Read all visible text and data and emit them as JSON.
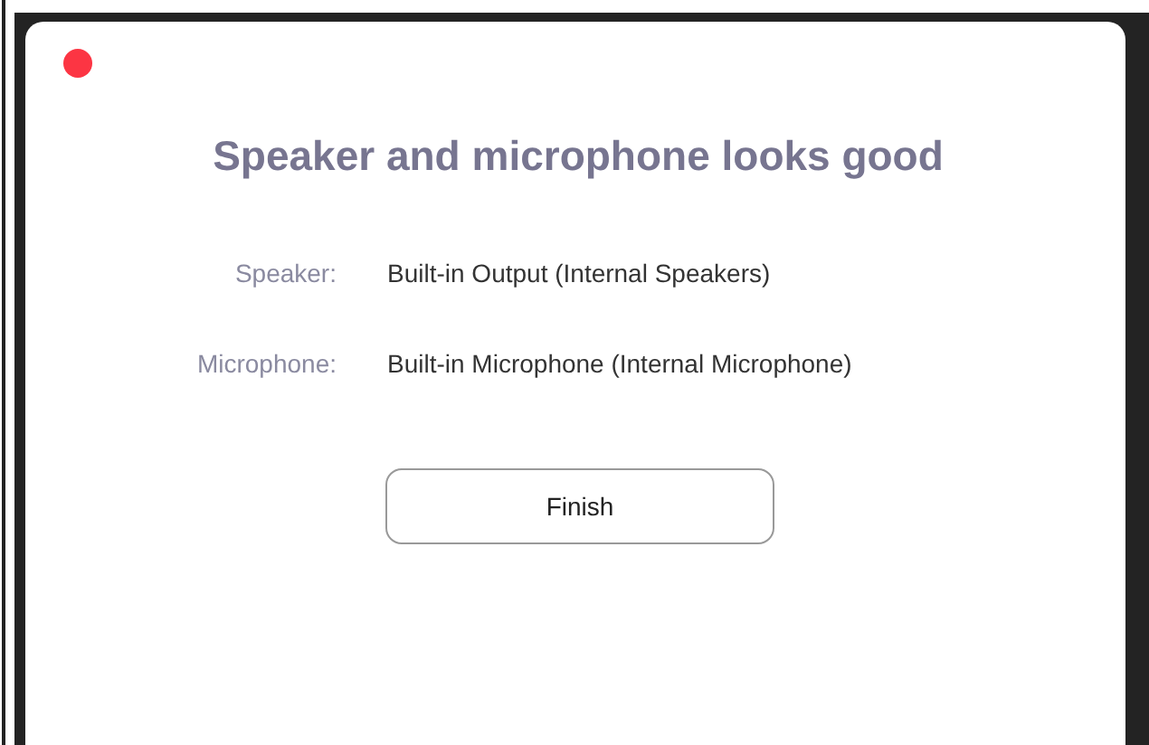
{
  "dialog": {
    "title": "Speaker and microphone looks good",
    "rows": [
      {
        "label": "Speaker:",
        "value": "Built-in Output (Internal Speakers)"
      },
      {
        "label": "Microphone:",
        "value": "Built-in Microphone (Internal Microphone)"
      }
    ],
    "button": "Finish"
  }
}
